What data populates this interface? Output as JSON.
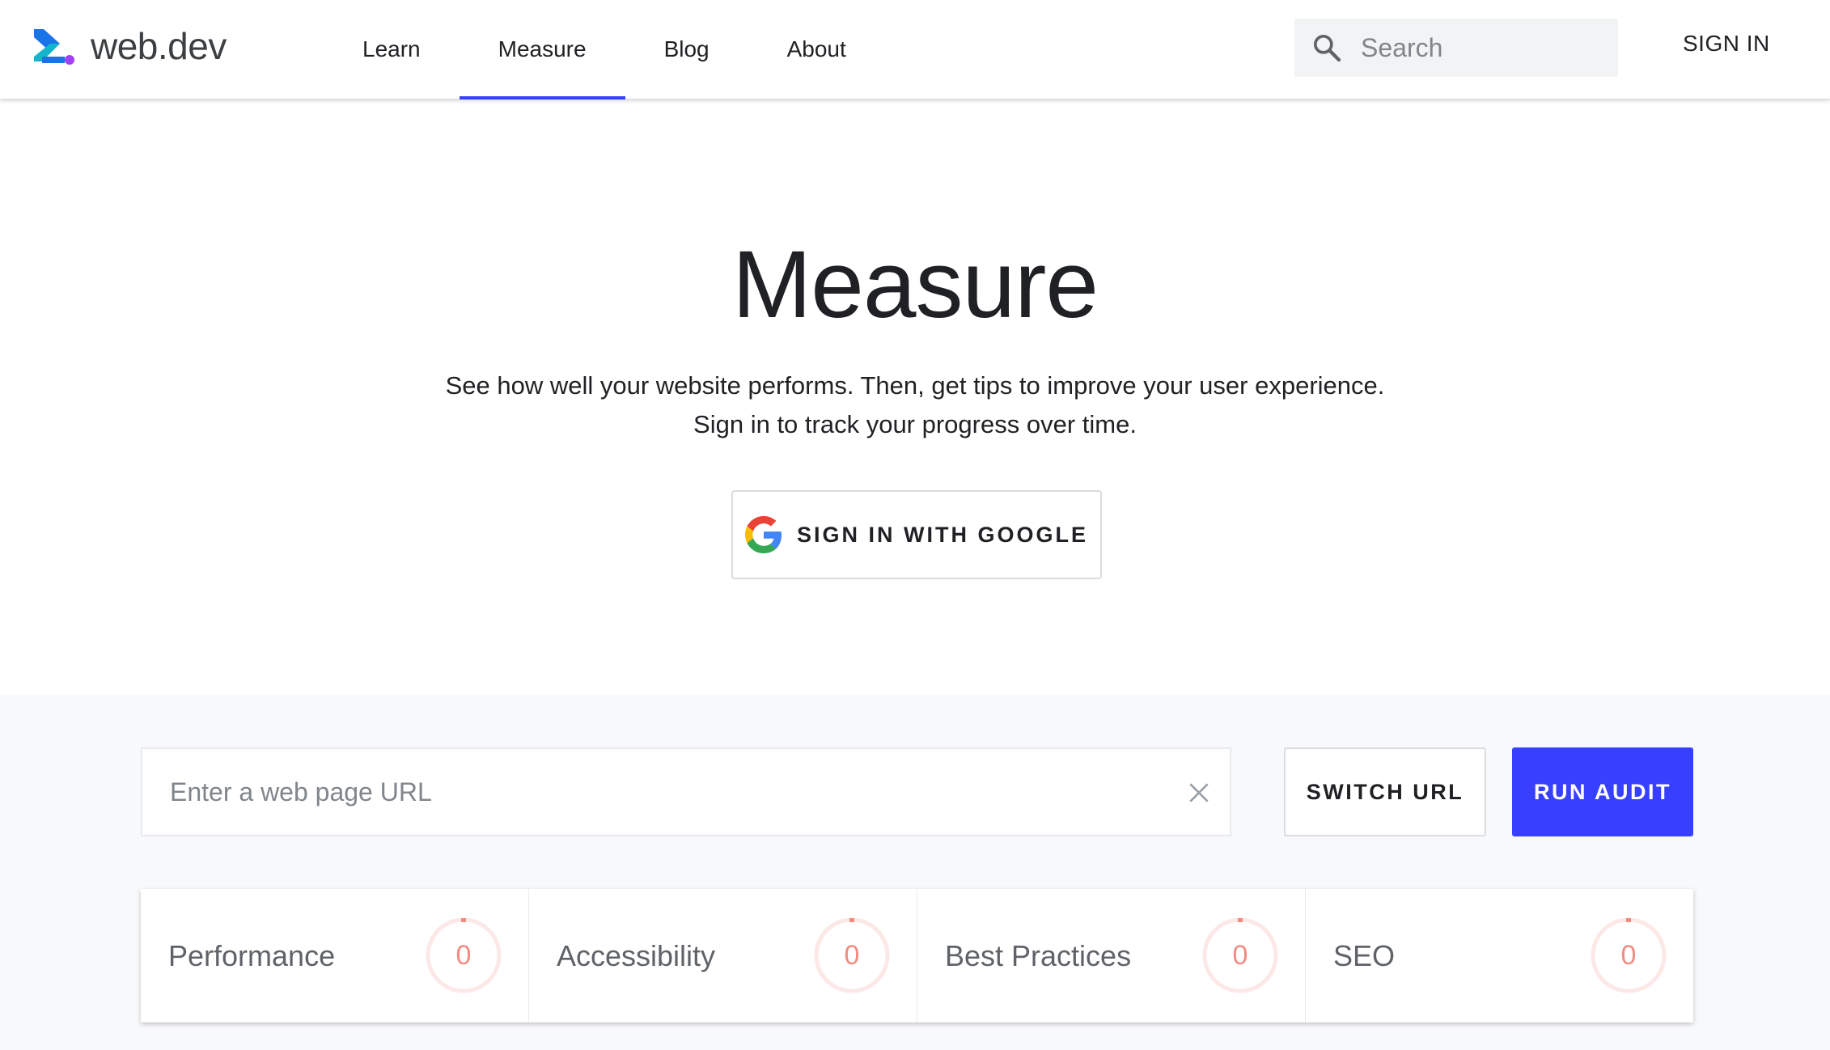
{
  "header": {
    "logo_text": "web.dev",
    "nav": [
      {
        "label": "Learn",
        "active": false
      },
      {
        "label": "Measure",
        "active": true
      },
      {
        "label": "Blog",
        "active": false
      },
      {
        "label": "About",
        "active": false
      }
    ],
    "search_placeholder": "Search",
    "sign_in_label": "SIGN IN"
  },
  "hero": {
    "title": "Measure",
    "description_line1": "See how well your website performs. Then, get tips to improve your user experience.",
    "description_line2": "Sign in to track your progress over time.",
    "google_button_label": "SIGN IN WITH GOOGLE"
  },
  "audit": {
    "url_placeholder": "Enter a web page URL",
    "url_value": "",
    "switch_url_label": "SWITCH URL",
    "run_audit_label": "RUN AUDIT",
    "scores": [
      {
        "label": "Performance",
        "value": "0"
      },
      {
        "label": "Accessibility",
        "value": "0"
      },
      {
        "label": "Best Practices",
        "value": "0"
      },
      {
        "label": "SEO",
        "value": "0"
      }
    ]
  },
  "colors": {
    "accent": "#3740ff",
    "score_fail": "#f28b82",
    "audit_background": "#f8f9fa"
  },
  "icons": [
    "webdev-logo-icon",
    "search-icon",
    "google-g-icon",
    "close-icon",
    "score-gauge-icon"
  ]
}
